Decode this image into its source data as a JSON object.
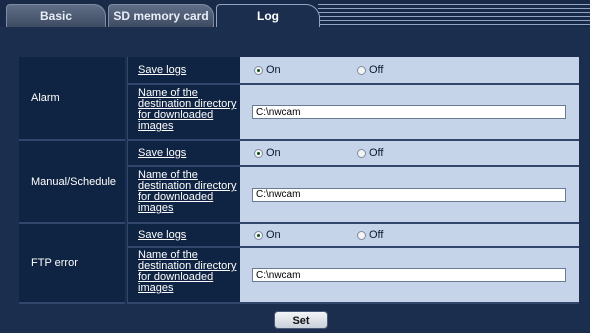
{
  "tabs": [
    {
      "label": "Basic",
      "active": false
    },
    {
      "label": "SD memory card",
      "active": false
    },
    {
      "label": "Log",
      "active": true
    }
  ],
  "sections": [
    {
      "name": "Alarm",
      "save_logs_label": "Save logs",
      "on_label": "On",
      "off_label": "Off",
      "selected": "On",
      "dir_label_lines": [
        "Name of the",
        "destination directory",
        "for downloaded",
        "images"
      ],
      "dir_value": "C:\\nwcam"
    },
    {
      "name": "Manual/Schedule",
      "save_logs_label": "Save logs",
      "on_label": "On",
      "off_label": "Off",
      "selected": "On",
      "dir_label_lines": [
        "Name of the",
        "destination directory",
        "for downloaded",
        "images"
      ],
      "dir_value": "C:\\nwcam"
    },
    {
      "name": "FTP error",
      "save_logs_label": "Save logs",
      "on_label": "On",
      "off_label": "Off",
      "selected": "On",
      "dir_label_lines": [
        "Name of the",
        "destination directory",
        "for downloaded",
        "images"
      ],
      "dir_value": "C:\\nwcam"
    }
  ],
  "set_button": "Set",
  "colors": {
    "background": "#1b2e4e",
    "label_cell": "#0f2442",
    "value_cell": "#c5d4e8"
  }
}
